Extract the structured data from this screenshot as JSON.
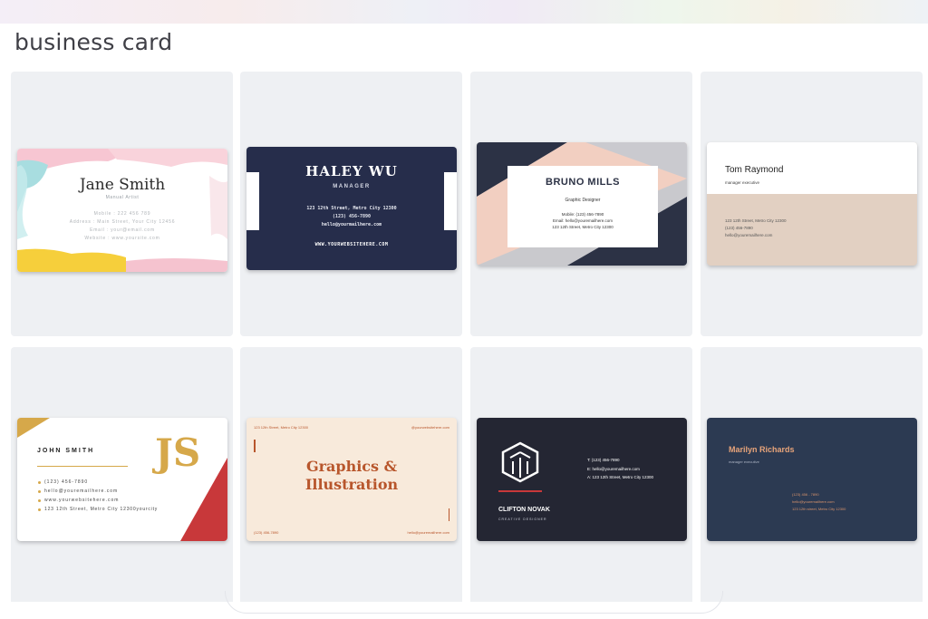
{
  "page": {
    "title": "business card"
  },
  "cards": {
    "jane": {
      "name": "Jane Smith",
      "role": "Manual Artist",
      "lines": [
        "Mobile : 222 456 789",
        "Address : Main Street, Your City 12456",
        "Email : your@email.com",
        "Website : www.yoursite.com"
      ]
    },
    "haley": {
      "name": "HALEY WU",
      "role": "MANAGER",
      "lines": [
        "123 12th Street, Metro City 12300",
        "(123) 456-7890",
        "hello@yourmailhere.com"
      ],
      "website": "WWW.YOURWEBSITEHERE.COM"
    },
    "bruno": {
      "name": "BRUNO MILLS",
      "role": "Graphic Designer",
      "lines": [
        "Mobile: (123) 456-7890",
        "Email: hello@youremailhere.com",
        "123 12th Street, Metro City 12300"
      ]
    },
    "tom": {
      "name": "Tom Raymond",
      "role": "manager executive",
      "lines": [
        "123 12th Street, Metro City 12300",
        "(123) 456-7890",
        "hello@youremailhere.com"
      ]
    },
    "john": {
      "name": "JOHN SMITH",
      "monogram": "JS",
      "lines": [
        "(123) 456-7890",
        "hello@youremailhere.com",
        "www.yourwebsitehere.com",
        "123 12th Street, Metro City 12300yourcity"
      ]
    },
    "graphics": {
      "title_line1": "Graphics &",
      "title_line2": "Illustration",
      "top_left": "123 12th Street, Metro City 12300",
      "top_right": "@yourwebsitehere.com",
      "bottom_left": "(123) 456-7890",
      "bottom_right": "hello@youremailhere.com"
    },
    "clifton": {
      "name": "CLIFTON NOVAK",
      "role": "CREATIVE DESIGNER",
      "lines": [
        "T: (123) 456-7890",
        "E: hello@youremailhere.com",
        "A: 123 12th Street, Metro City 12300"
      ]
    },
    "marilyn": {
      "name": "Marilyn Richards",
      "role": "manager executive",
      "lines": [
        "(123) 456 - 7890",
        "hello@youremailhere.com",
        "123 12th street, Metro City 12300"
      ]
    }
  },
  "colors": {
    "tile_bg": "#eef0f3",
    "navy": "#262d4b",
    "gold": "#d6a84a",
    "red": "#c8383a",
    "rust": "#b8562c",
    "beige": "#e2d0c2",
    "dark": "#242633",
    "slate": "#2c3a52",
    "peach": "#f2cfc1"
  },
  "icons": {
    "clifton_logo": "hexagon-logo-icon"
  }
}
